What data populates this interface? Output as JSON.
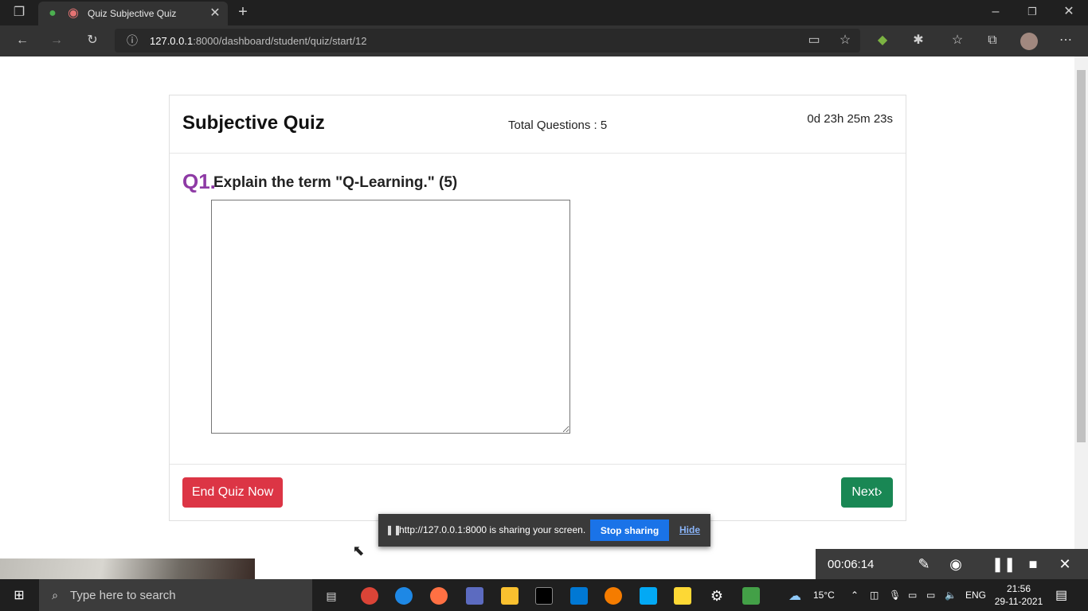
{
  "browser": {
    "tab_title": "Quiz Subjective Quiz",
    "url_host": "127.0.0.1",
    "url_path": ":8000/dashboard/student/quiz/start/12"
  },
  "quiz": {
    "title": "Subjective Quiz",
    "total_questions": "Total Questions : 5",
    "timer": "0d 23h 25m 23s",
    "question_number": "Q1.",
    "question_text": "Explain the term \"Q-Learning.\" (5)",
    "answer_value": "",
    "end_button": "End Quiz Now",
    "next_button": "Next›"
  },
  "sharing_bar": {
    "message": "http://127.0.0.1:8000 is sharing your screen.",
    "stop_label": "Stop sharing",
    "hide_label": "Hide"
  },
  "recorder": {
    "elapsed": "00:06:14"
  },
  "taskbar": {
    "search_placeholder": "Type here to search",
    "weather": "15°C",
    "language": "ENG",
    "time": "21:56",
    "date": "29-11-2021"
  }
}
